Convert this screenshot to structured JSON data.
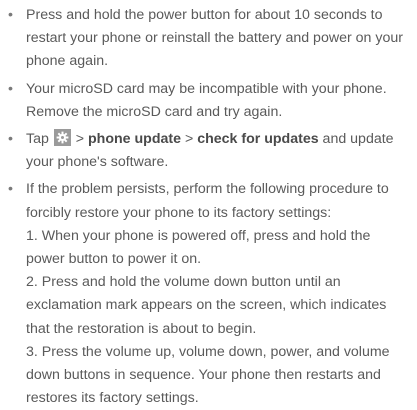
{
  "bullet_symbol": "•",
  "items": [
    {
      "text": "Press and hold the power button for about 10 seconds to restart your phone or reinstall the battery and power on your phone again."
    },
    {
      "text": "Your microSD card may be incompatible with your phone. Remove the microSD card and try again."
    },
    {
      "prefix": "Tap ",
      "icon": "settings-gear-icon",
      "sep1": " > ",
      "bold1": "phone update",
      "sep2": " > ",
      "bold2": "check for updates",
      "suffix": " and update your phone's software."
    },
    {
      "text": "If the problem persists, perform the following procedure to forcibly restore your phone to its factory settings:",
      "steps": [
        "1. When your phone is powered off, press and hold the power button to power it on.",
        "2. Press and hold the volume down button until an exclamation mark appears on the screen, which indicates that the restoration is about to begin.",
        "3. Press the volume up, volume down, power, and volume down buttons in sequence. Your phone then restarts and restores its factory settings."
      ]
    }
  ]
}
